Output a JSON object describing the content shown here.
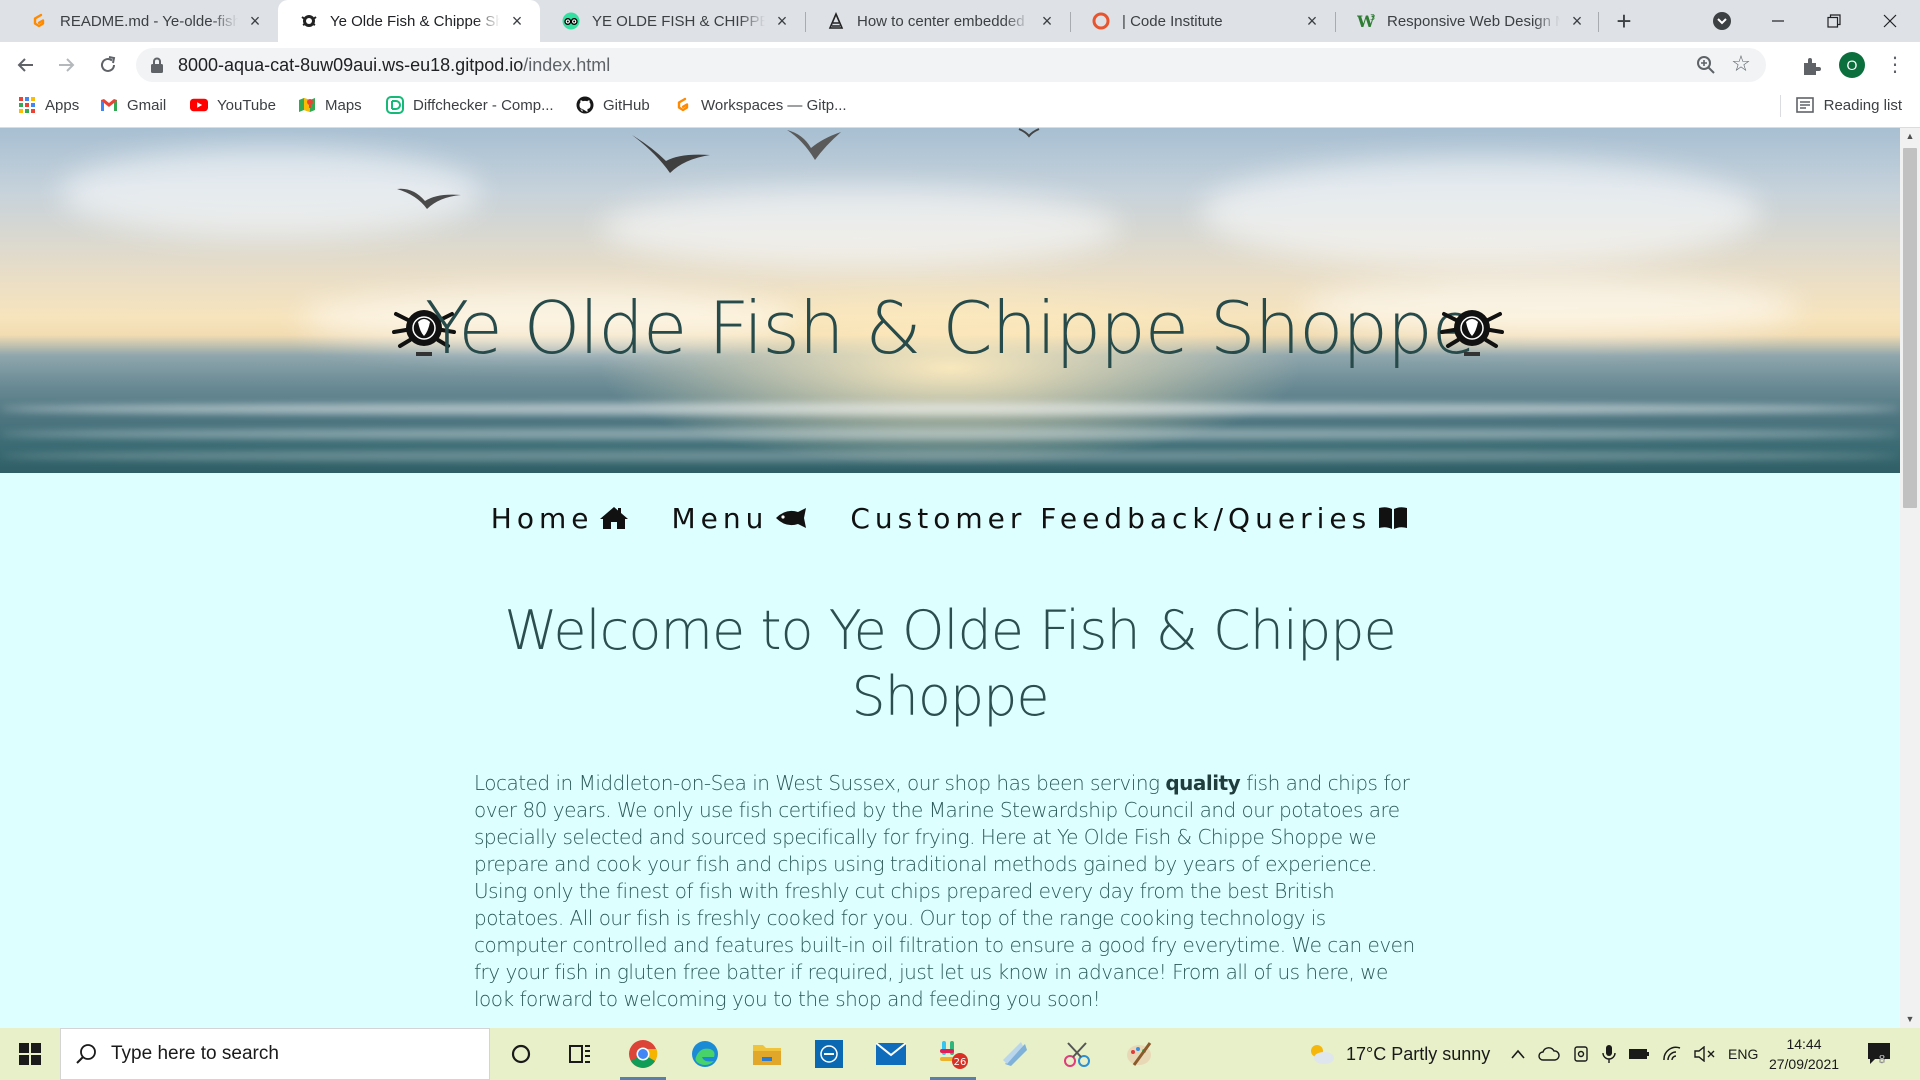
{
  "browser": {
    "tabs": [
      {
        "title": "README.md - Ye-olde-fish-",
        "icon": "gitpod-icon",
        "active": false
      },
      {
        "title": "Ye Olde Fish & Chippe Shop",
        "icon": "crest-icon",
        "active": true
      },
      {
        "title": "YE OLDE FISH & CHIPPE SH",
        "icon": "tripadvisor-icon",
        "active": false
      },
      {
        "title": "How to center embedded G",
        "icon": "page-icon",
        "active": false
      },
      {
        "title": "| Code Institute",
        "icon": "code-institute-icon",
        "active": false
      },
      {
        "title": "Responsive Web Design Me",
        "icon": "w-icon",
        "active": false
      }
    ],
    "new_tab_label": "+",
    "address": {
      "host": "8000-aqua-cat-8uw09aui.ws-eu18.gitpod.io",
      "path": "/index.html"
    },
    "profile_initial": "O",
    "bookmarks": [
      {
        "label": "Apps",
        "icon": "apps-grid-icon"
      },
      {
        "label": "Gmail",
        "icon": "gmail-icon"
      },
      {
        "label": "YouTube",
        "icon": "youtube-icon"
      },
      {
        "label": "Maps",
        "icon": "maps-icon"
      },
      {
        "label": "Diffchecker - Comp...",
        "icon": "diffchecker-icon"
      },
      {
        "label": "GitHub",
        "icon": "github-icon"
      },
      {
        "label": "Workspaces — Gitp...",
        "icon": "gitpod-icon"
      }
    ],
    "reading_list_label": "Reading list"
  },
  "page": {
    "hero_title": "Ye Olde Fish & Chippe Shoppe",
    "nav": [
      {
        "label": "Home",
        "icon": "home-icon"
      },
      {
        "label": "Menu",
        "icon": "fish-icon"
      },
      {
        "label": "Customer Feedback/Queries",
        "icon": "book-open-icon"
      }
    ],
    "welcome_heading": "Welcome to Ye Olde Fish & Chippe Shoppe",
    "intro": {
      "before_bold": "Located in Middleton-on-Sea in West Sussex, our shop has been serving ",
      "bold": "quality",
      "after_bold": " fish and chips for over 80 years. We only use fish certified by the Marine Stewardship Council and our potatoes are specially selected and sourced specifically for frying. Here at Ye Olde Fish & Chippe Shoppe we prepare and cook your fish and chips using traditional methods gained by years of experience. Using only the finest of fish with freshly cut chips prepared every day from the best British potatoes. All our fish is freshly cooked for you. Our top of the range cooking technology is computer controlled and features built-in oil filtration to ensure a good fry everytime. We can even fry your fish in gluten free batter if required, just let us know in advance! From all of us here, we look forward to welcoming you to the shop and feeding you soon!"
    }
  },
  "taskbar": {
    "search_placeholder": "Type here to search",
    "weather": "17°C  Partly sunny",
    "language": "ENG",
    "time": "14:44",
    "date": "27/09/2021",
    "notification_count": "8",
    "chat_badge": "26"
  },
  "colors": {
    "page_background": "#ddffff",
    "heading": "#2c4e4e",
    "taskbar": "#e7f0c8"
  }
}
